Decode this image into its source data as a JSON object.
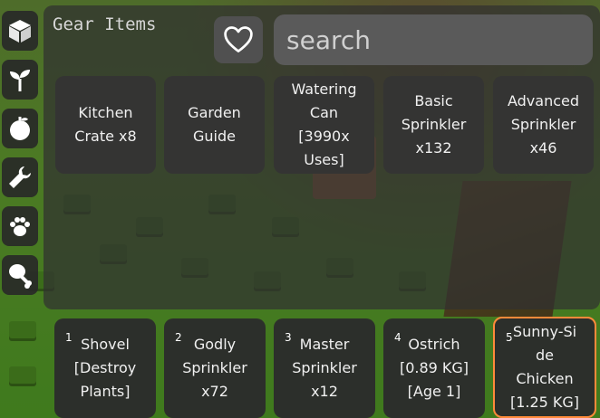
{
  "panel": {
    "title": "Gear Items",
    "search_placeholder": "search"
  },
  "categories": [
    {
      "icon": "crate-icon"
    },
    {
      "icon": "sprout-icon"
    },
    {
      "icon": "fruit-icon"
    },
    {
      "icon": "wrench-icon"
    },
    {
      "icon": "paw-icon"
    },
    {
      "icon": "drumstick-icon"
    }
  ],
  "gear_items": [
    {
      "label": "Kitchen\nCrate x8"
    },
    {
      "label": "Garden\nGuide"
    },
    {
      "label": "Watering\nCan\n[3990x\nUses]"
    },
    {
      "label": "Basic\nSprinkler\nx132"
    },
    {
      "label": "Advanced\nSprinkler\nx46"
    }
  ],
  "hotbar": [
    {
      "slot": "1",
      "label": "Shovel\n[Destroy\nPlants]"
    },
    {
      "slot": "2",
      "label": "Godly\nSprinkler\nx72"
    },
    {
      "slot": "3",
      "label": "Master\nSprinkler\nx12"
    },
    {
      "slot": "4",
      "label": "Ostrich\n[0.89 KG]\n[Age 1]"
    },
    {
      "slot": "5",
      "label": "Sunny-Si\nde\nChicken\n[1.25 KG]"
    }
  ],
  "colors": {
    "selected_border": "#ff8a3a"
  }
}
